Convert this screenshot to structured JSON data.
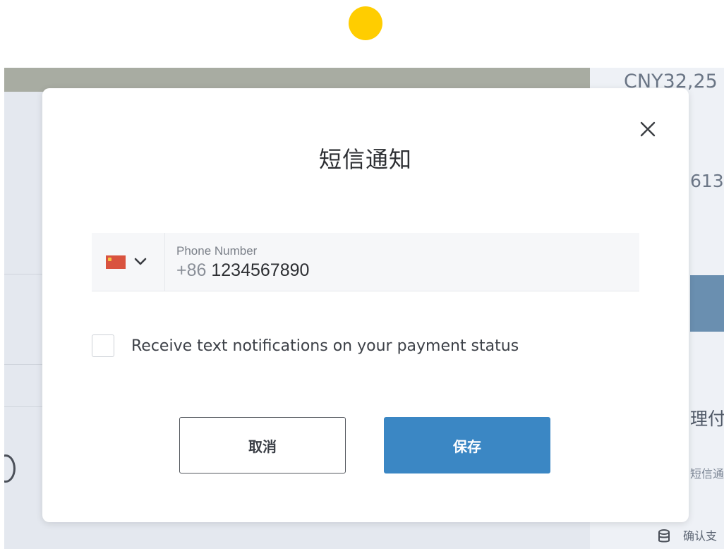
{
  "background": {
    "amount_text": "CNY32,25",
    "number_text": "613",
    "heading_text": "理付款",
    "sms_text": "短信通",
    "confirm_text": "确认支",
    "db_icon": "database-icon"
  },
  "modal": {
    "title": "短信通知",
    "close_icon": "close-icon",
    "phone": {
      "country_flag_icon": "china-flag-icon",
      "chevron_icon": "chevron-down-icon",
      "label": "Phone Number",
      "prefix": "+86",
      "value": "1234567890"
    },
    "checkbox": {
      "checked": false,
      "label": "Receive text notifications on your payment status"
    },
    "buttons": {
      "cancel_label": "取消",
      "save_label": "保存"
    }
  },
  "colors": {
    "accent_yellow": "#ffcd00",
    "save_blue": "#3b87c4",
    "flag_red": "#d9533f",
    "flag_star": "#f4c542"
  }
}
